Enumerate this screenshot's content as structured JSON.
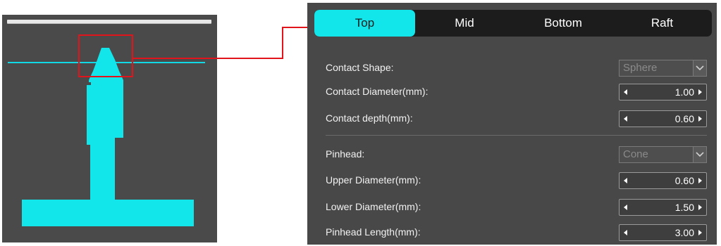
{
  "tabs": [
    {
      "label": "Top",
      "active": true
    },
    {
      "label": "Mid",
      "active": false
    },
    {
      "label": "Bottom",
      "active": false
    },
    {
      "label": "Raft",
      "active": false
    }
  ],
  "settings": {
    "contact_shape": {
      "label": "Contact Shape:",
      "value": "Sphere"
    },
    "contact_diameter": {
      "label": "Contact Diameter(mm):",
      "value": "1.00"
    },
    "contact_depth": {
      "label": "Contact depth(mm):",
      "value": "0.60"
    },
    "pinhead": {
      "label": "Pinhead:",
      "value": "Cone"
    },
    "upper_diameter": {
      "label": "Upper Diameter(mm):",
      "value": "0.60"
    },
    "lower_diameter": {
      "label": "Lower Diameter(mm):",
      "value": "1.50"
    },
    "pinhead_length": {
      "label": "Pinhead Length(mm):",
      "value": "3.00"
    }
  },
  "colors": {
    "accent": "#12e6ea",
    "highlight_box": "#e0141a",
    "panel_bg": "#484848",
    "preview_bg": "#4a4a4a"
  },
  "icons": {
    "dropdown": "chevron-down-icon",
    "decrement": "triangle-left-icon",
    "increment": "triangle-right-icon"
  }
}
